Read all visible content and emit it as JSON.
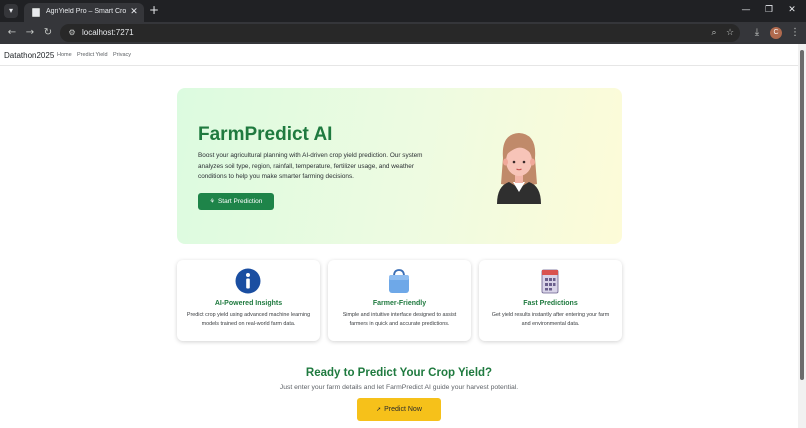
{
  "browser": {
    "tab_title": "AgriYield Pro – Smart Crop Yield",
    "url": "localhost:7271",
    "avatar_initial": "C",
    "icons": [
      "tab-search-icon",
      "page-icon",
      "close-icon",
      "plus-icon",
      "minimize-icon",
      "restore-icon",
      "close-window-icon",
      "back-icon",
      "forward-icon",
      "reload-icon",
      "site-info-icon",
      "zoom-icon",
      "star-icon",
      "download-icon",
      "more-icon"
    ]
  },
  "nav": {
    "brand": "Datathon2025",
    "links": [
      "Home",
      "Predict Yield",
      "Privacy"
    ]
  },
  "hero": {
    "title": "FarmPredict AI",
    "description": "Boost your agricultural planning with AI-driven crop yield prediction. Our system analyzes soil type, region, rainfall, temperature, fertilizer usage, and weather conditions to help you make smarter farming decisions.",
    "button_label": "Start Prediction",
    "button_icon": "seedling-icon",
    "illustration": "farmer-avatar"
  },
  "features": [
    {
      "icon": "info-icon",
      "title": "AI-Powered Insights",
      "description": "Predict crop yield using advanced machine learning models trained on real-world farm data."
    },
    {
      "icon": "shopping-bag-icon",
      "title": "Farmer-Friendly",
      "description": "Simple and intuitive interface designed to assist farmers in quick and accurate predictions."
    },
    {
      "icon": "calendar-icon",
      "title": "Fast Predictions",
      "description": "Get yield results instantly after entering your farm and environmental data."
    }
  ],
  "cta": {
    "title": "Ready to Predict Your Crop Yield?",
    "subtitle": "Just enter your farm details and let FarmPredict AI guide your harvest potential.",
    "button_label": "Predict Now",
    "button_icon": "rocket-icon"
  },
  "colors": {
    "brand_green": "#1f7a3f",
    "button_green": "#1e8449",
    "cta_yellow": "#f6c11a",
    "hero_gradient_start": "#dcfbe0",
    "hero_gradient_end": "#fdfbd8"
  }
}
